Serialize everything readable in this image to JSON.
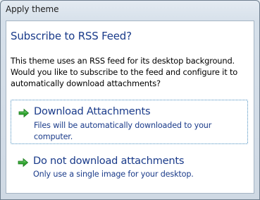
{
  "window": {
    "title": "Apply theme"
  },
  "dialog": {
    "main_instruction": "Subscribe to RSS Feed?",
    "content": "This theme uses an RSS feed for its desktop background. Would you like to subscribe to the feed and configure it to automatically download attachments?"
  },
  "commands": [
    {
      "label": "Download Attachments",
      "note": "Files will be automatically downloaded to your computer.",
      "icon": "green-arrow-icon",
      "focused": true
    },
    {
      "label": "Do not download attachments",
      "note": "Only use a single image for your desktop.",
      "icon": "green-arrow-icon",
      "focused": false
    }
  ],
  "colors": {
    "instruction": "#1a3b8a",
    "command_text": "#1a3b8a",
    "arrow": "#2fa32f",
    "focus_border": "#4a8fbf"
  }
}
